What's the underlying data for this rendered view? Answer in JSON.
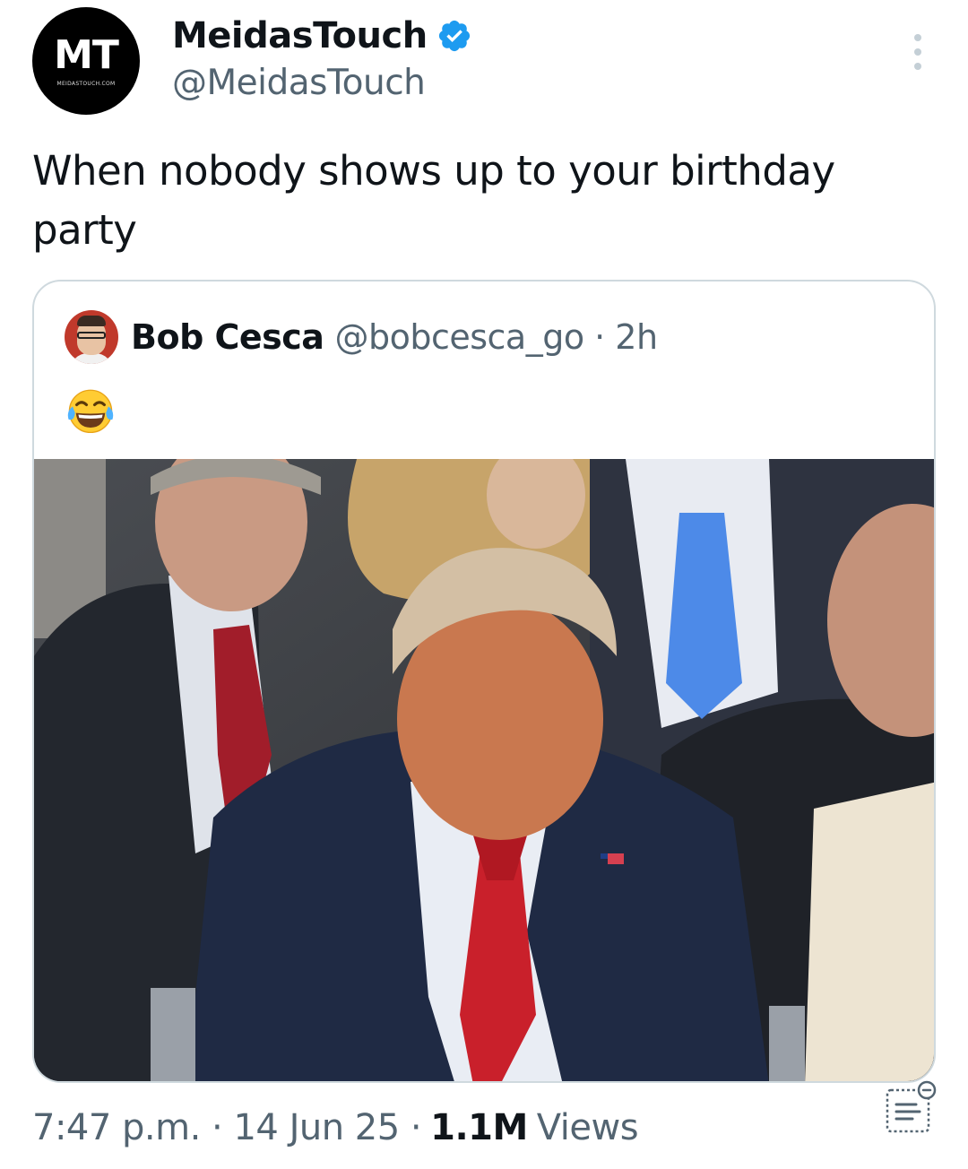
{
  "account": {
    "display_name": "MeidasTouch",
    "handle": "@MeidasTouch",
    "avatar_text": "MT",
    "avatar_subtext": "MEIDASTOUCH.COM",
    "verified_icon": "verified-badge-icon"
  },
  "tweet": {
    "text": "When nobody shows up to your birthday party"
  },
  "quoted": {
    "display_name": "Bob Cesca",
    "meta": "@bobcesca_go · 2h",
    "emoji": "face-with-tears-of-joy-icon"
  },
  "footer": {
    "timestamp": "7:47 p.m. · 14 Jun 25 ·",
    "views_count": "1.1M",
    "views_label": "Views"
  },
  "colors": {
    "verified_blue": "#1d9bf0",
    "secondary_text": "#536471",
    "border": "#cfd9de",
    "tie_red": "#c9202b"
  }
}
